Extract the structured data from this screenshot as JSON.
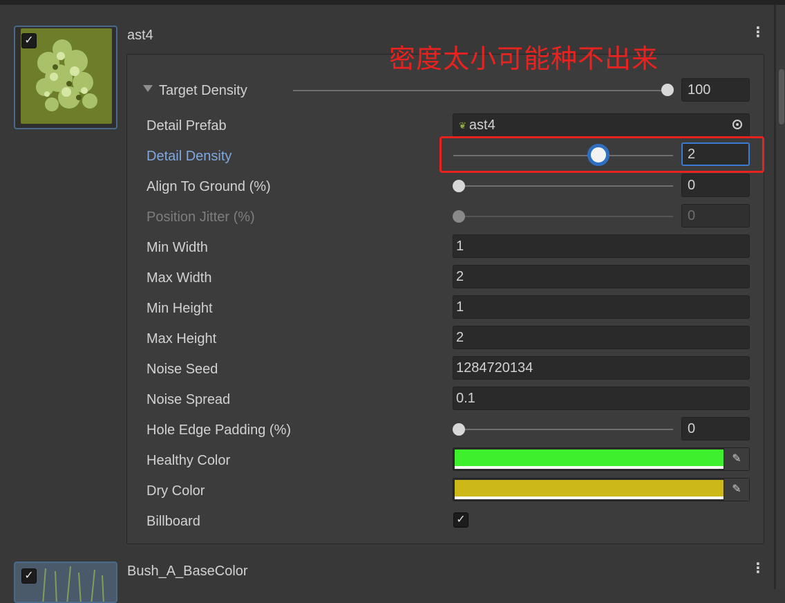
{
  "item1": {
    "title": "ast4",
    "enabled": "✓"
  },
  "item2": {
    "title": "Bush_A_BaseColor",
    "enabled": "✓"
  },
  "menu_icon": "⋮",
  "annotation": "密度太小可能种不出来",
  "target_density": {
    "label": "Target Density",
    "value": "100",
    "level": 1.0
  },
  "detail_prefab": {
    "label": "Detail Prefab",
    "value": "ast4"
  },
  "detail_density": {
    "label": "Detail Density",
    "value": "2",
    "level": 0.66
  },
  "align_to_ground": {
    "label": "Align To Ground (%)",
    "value": "0",
    "level": 0.0
  },
  "position_jitter": {
    "label": "Position Jitter (%)",
    "value": "0",
    "level": 0.0
  },
  "min_width": {
    "label": "Min Width",
    "value": "1"
  },
  "max_width": {
    "label": "Max Width",
    "value": "2"
  },
  "min_height": {
    "label": "Min Height",
    "value": "1"
  },
  "max_height": {
    "label": "Max Height",
    "value": "2"
  },
  "noise_seed": {
    "label": "Noise Seed",
    "value": "1284720134"
  },
  "noise_spread": {
    "label": "Noise Spread",
    "value": "0.1"
  },
  "hole_edge_padding": {
    "label": "Hole Edge Padding (%)",
    "value": "0",
    "level": 0.0
  },
  "healthy_color": {
    "label": "Healthy Color",
    "color": "#3ef02b"
  },
  "dry_color": {
    "label": "Dry Color",
    "color": "#cdb81a"
  },
  "billboard": {
    "label": "Billboard",
    "checked": "✓"
  },
  "colors": {
    "annotation_red": "#e8231f",
    "focus_blue": "#3b7bd4",
    "active_label": "#7fa8e0"
  },
  "icons": {
    "prefab": "leaf-icon",
    "object_picker": "target-icon",
    "eyedropper": "eyedropper-icon"
  }
}
